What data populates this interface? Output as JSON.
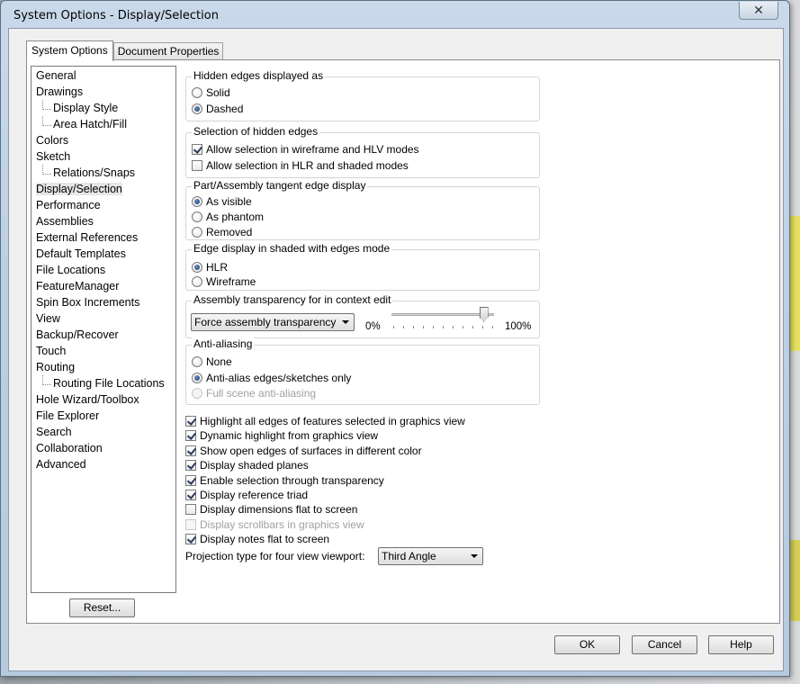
{
  "window": {
    "title": "System Options - Display/Selection",
    "close": "✕"
  },
  "tabs": [
    "System Options",
    "Document Properties"
  ],
  "nav": [
    {
      "label": "General",
      "child": false
    },
    {
      "label": "Drawings",
      "child": false
    },
    {
      "label": "Display Style",
      "child": true
    },
    {
      "label": "Area Hatch/Fill",
      "child": true
    },
    {
      "label": "Colors",
      "child": false
    },
    {
      "label": "Sketch",
      "child": false
    },
    {
      "label": "Relations/Snaps",
      "child": true
    },
    {
      "label": "Display/Selection",
      "child": false,
      "selected": true
    },
    {
      "label": "Performance",
      "child": false
    },
    {
      "label": "Assemblies",
      "child": false
    },
    {
      "label": "External References",
      "child": false
    },
    {
      "label": "Default Templates",
      "child": false
    },
    {
      "label": "File Locations",
      "child": false
    },
    {
      "label": "FeatureManager",
      "child": false
    },
    {
      "label": "Spin Box Increments",
      "child": false
    },
    {
      "label": "View",
      "child": false
    },
    {
      "label": "Backup/Recover",
      "child": false
    },
    {
      "label": "Touch",
      "child": false
    },
    {
      "label": "Routing",
      "child": false
    },
    {
      "label": "Routing File Locations",
      "child": true
    },
    {
      "label": "Hole Wizard/Toolbox",
      "child": false
    },
    {
      "label": "File Explorer",
      "child": false
    },
    {
      "label": "Search",
      "child": false
    },
    {
      "label": "Collaboration",
      "child": false
    },
    {
      "label": "Advanced",
      "child": false
    }
  ],
  "reset_label": "Reset...",
  "hidden_edges": {
    "title": "Hidden edges displayed as",
    "options": [
      {
        "label": "Solid",
        "on": false
      },
      {
        "label": "Dashed",
        "on": true
      }
    ]
  },
  "selection_hidden": {
    "title": "Selection of hidden edges",
    "options": [
      {
        "label": "Allow selection in wireframe and HLV modes",
        "on": true
      },
      {
        "label": "Allow selection in HLR and shaded modes",
        "on": false
      }
    ]
  },
  "tangent": {
    "title": "Part/Assembly tangent edge display",
    "options": [
      {
        "label": "As visible",
        "on": true
      },
      {
        "label": "As phantom",
        "on": false
      },
      {
        "label": "Removed",
        "on": false
      }
    ]
  },
  "edge_shaded": {
    "title": "Edge display in shaded with edges mode",
    "options": [
      {
        "label": "HLR",
        "on": true
      },
      {
        "label": "Wireframe",
        "on": false
      }
    ]
  },
  "transparency": {
    "title": "Assembly transparency for in context edit",
    "combo": "Force assembly transparency",
    "min": "0%",
    "max": "100%",
    "level": 0.9
  },
  "antialias": {
    "title": "Anti-aliasing",
    "options": [
      {
        "label": "None",
        "on": false,
        "disabled": false
      },
      {
        "label": "Anti-alias edges/sketches only",
        "on": true,
        "disabled": false
      },
      {
        "label": "Full scene anti-aliasing",
        "on": false,
        "disabled": true
      }
    ]
  },
  "checks": [
    {
      "label": "Highlight all edges of features selected in graphics view",
      "on": true,
      "disabled": false
    },
    {
      "label": "Dynamic highlight from graphics view",
      "on": true,
      "disabled": false
    },
    {
      "label": "Show open edges of surfaces in different color",
      "on": true,
      "disabled": false
    },
    {
      "label": "Display shaded planes",
      "on": true,
      "disabled": false
    },
    {
      "label": "Enable selection through transparency",
      "on": true,
      "disabled": false
    },
    {
      "label": "Display reference triad",
      "on": true,
      "disabled": false
    },
    {
      "label": "Display dimensions flat to screen",
      "on": false,
      "disabled": false
    },
    {
      "label": "Display scrollbars in graphics view",
      "on": false,
      "disabled": true
    },
    {
      "label": "Display notes flat to screen",
      "on": true,
      "disabled": false
    }
  ],
  "projection": {
    "label": "Projection type for four view viewport:",
    "value": "Third Angle"
  },
  "buttons": {
    "ok": "OK",
    "cancel": "Cancel",
    "help": "Help"
  }
}
